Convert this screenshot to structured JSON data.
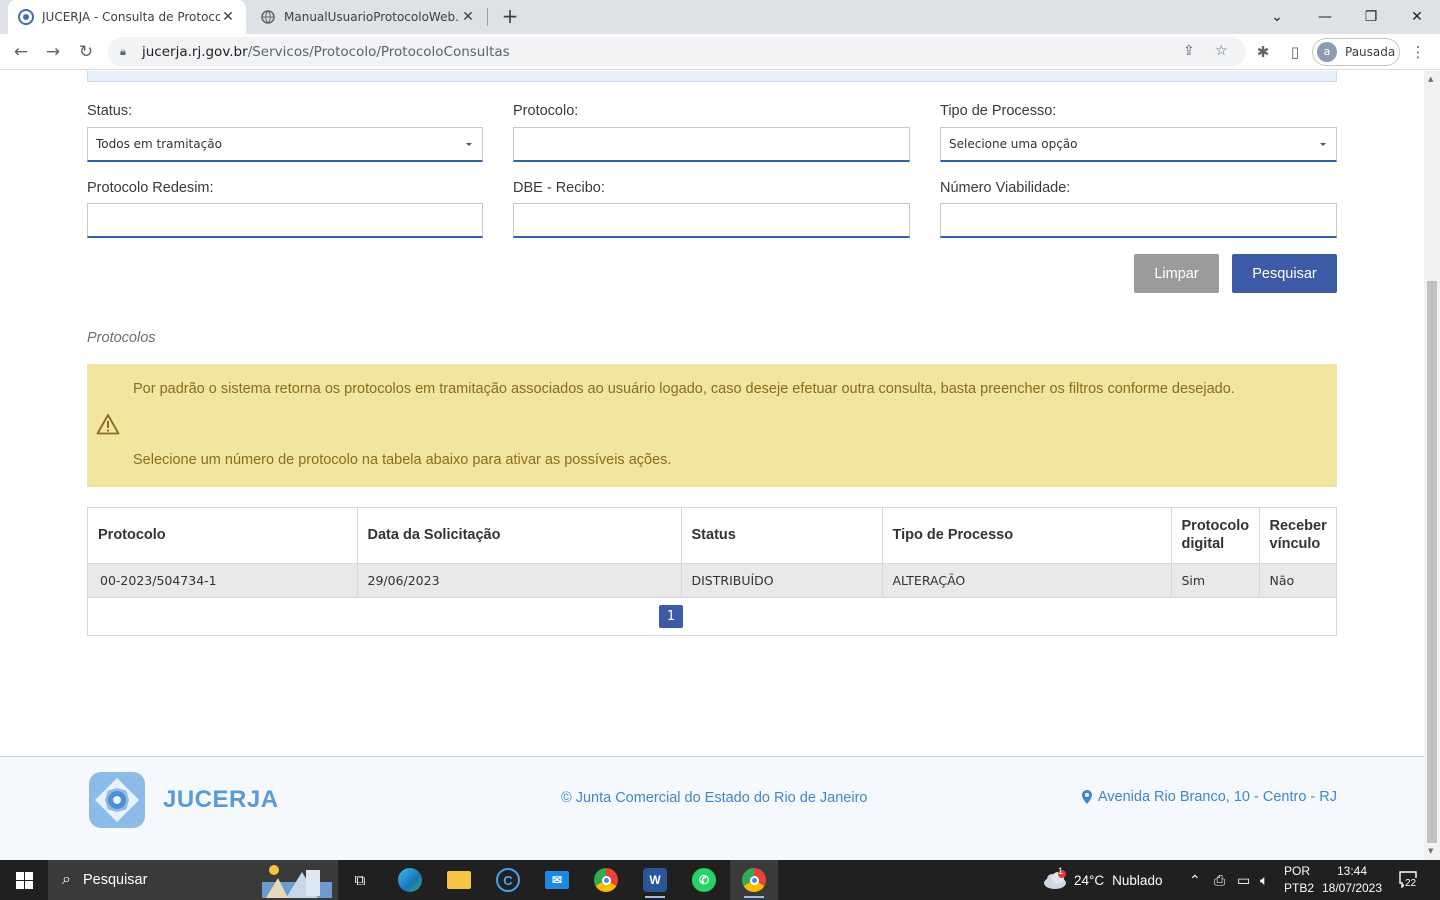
{
  "browser": {
    "tabs": [
      {
        "title": "JUCERJA - Consulta de Protocolo",
        "active": true
      },
      {
        "title": "ManualUsuarioProtocoloWeb.pdf",
        "active": false
      }
    ],
    "url_domain": "jucerja.rj.gov.br",
    "url_path": "/Servicos/Protocolo/ProtocoloConsultas",
    "profile_initial": "a",
    "profile_label": "Pausada"
  },
  "form": {
    "status_label": "Status:",
    "status_value": "Todos em tramitação",
    "protocolo_label": "Protocolo:",
    "protocolo_value": "",
    "tipo_label": "Tipo de Processo:",
    "tipo_value": "Selecione uma opção",
    "redesim_label": "Protocolo Redesim:",
    "redesim_value": "",
    "dbe_label": "DBE - Recibo:",
    "dbe_value": "",
    "viabilidade_label": "Número Viabilidade:",
    "viabilidade_value": "",
    "clear_button": "Limpar",
    "search_button": "Pesquisar"
  },
  "results": {
    "section_title": "Protocolos",
    "alert_line1": "Por padrão o sistema retorna os protocolos em tramitação associados ao usuário logado, caso deseje efetuar outra consulta, basta preencher os filtros conforme desejado.",
    "alert_line2": "Selecione um número de protocolo na tabela abaixo para ativar as possíveis ações.",
    "columns": [
      "Protocolo",
      "Data da Solicitação",
      "Status",
      "Tipo de Processo",
      "Protocolo digital",
      "Receber vínculo"
    ],
    "rows": [
      [
        "00-2023/504734-1",
        "29/06/2023",
        "DISTRIBUÍDO",
        "ALTERAÇÃO",
        "Sim",
        "Não"
      ]
    ],
    "current_page": "1"
  },
  "footer": {
    "brand": "JUCERJA",
    "copyright": "© Junta Comercial do Estado do Rio de Janeiro",
    "address": "Avenida Rio Branco, 10 - Centro - RJ"
  },
  "taskbar": {
    "search_placeholder": "Pesquisar",
    "weather_temp": "24°C",
    "weather_desc": "Nublado",
    "weather_badge": "1",
    "lang_top": "POR",
    "lang_bottom": "PTB2",
    "time": "13:44",
    "date": "18/07/2023",
    "notifications": "22"
  },
  "colors": {
    "primary": "#3d5aa7",
    "alert_bg": "#f2e59f",
    "alert_text": "#8a6d1e",
    "footer_link": "#3f87cc"
  }
}
